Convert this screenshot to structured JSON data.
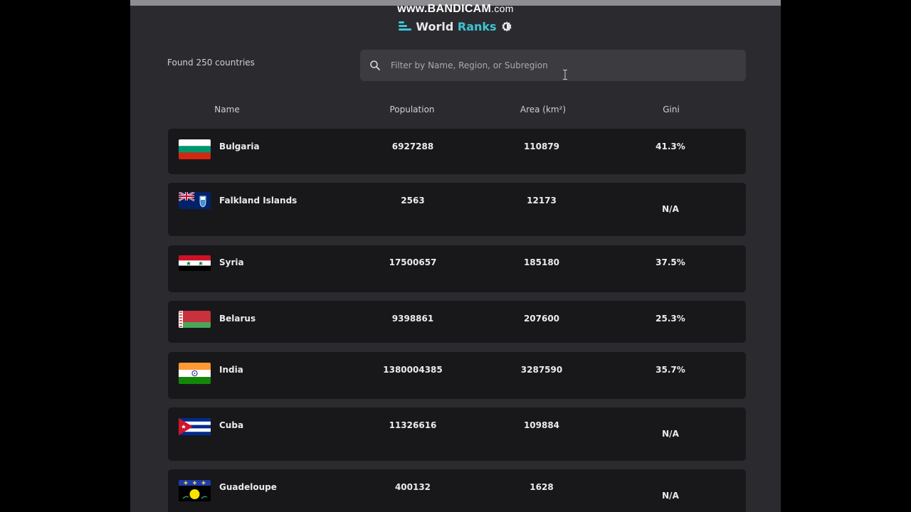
{
  "watermark": {
    "main": "www.BANDICAM",
    "suffix": ".com"
  },
  "brand": {
    "word1": "World",
    "word2": "Ranks"
  },
  "summary": {
    "found_text": "Found 250 countries"
  },
  "search": {
    "placeholder": "Filter by Name, Region, or Subregion",
    "value": ""
  },
  "columns": [
    "Name",
    "Population",
    "Area (km²)",
    "Gini"
  ],
  "colors": {
    "accent": "#3cc4d6",
    "background": "#2b2b2f",
    "row": "#18181b"
  },
  "rows": [
    {
      "name": "Bulgaria",
      "population": "6927288",
      "area": "110879",
      "gini": "41.3%",
      "flag": "bulgaria"
    },
    {
      "name": "Falkland Islands",
      "population": "2563",
      "area": "12173",
      "gini": "N/A",
      "flag": "falkland-islands"
    },
    {
      "name": "Syria",
      "population": "17500657",
      "area": "185180",
      "gini": "37.5%",
      "flag": "syria"
    },
    {
      "name": "Belarus",
      "population": "9398861",
      "area": "207600",
      "gini": "25.3%",
      "flag": "belarus"
    },
    {
      "name": "India",
      "population": "1380004385",
      "area": "3287590",
      "gini": "35.7%",
      "flag": "india"
    },
    {
      "name": "Cuba",
      "population": "11326616",
      "area": "109884",
      "gini": "N/A",
      "flag": "cuba"
    },
    {
      "name": "Guadeloupe",
      "population": "400132",
      "area": "1628",
      "gini": "N/A",
      "flag": "guadeloupe"
    }
  ]
}
